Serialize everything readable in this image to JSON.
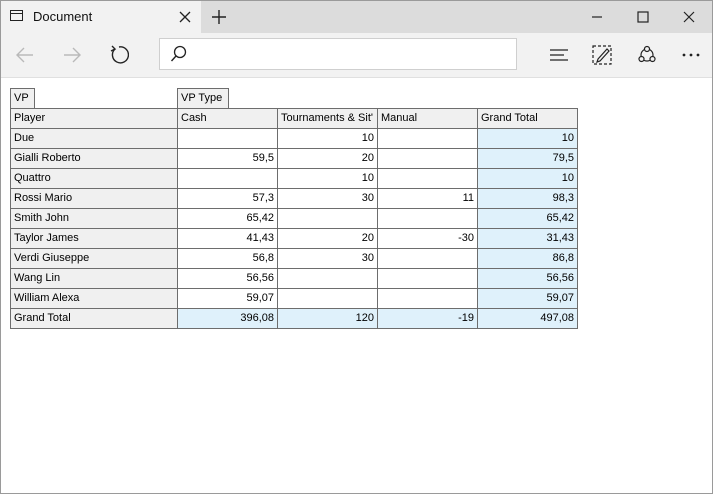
{
  "window": {
    "tab_title": "Document",
    "icons": {
      "tab": "document-icon",
      "close_tab": "close-icon",
      "new_tab": "plus-icon",
      "minimize": "minimize-icon",
      "maximize": "maximize-icon",
      "close": "close-icon"
    }
  },
  "navbar": {
    "address_value": "",
    "icons": {
      "back": "back-arrow-icon",
      "forward": "forward-arrow-icon",
      "refresh": "refresh-icon",
      "search": "search-icon",
      "hub": "hub-icon",
      "notes": "web-note-icon",
      "share": "share-icon",
      "more": "more-icon"
    }
  },
  "pivot": {
    "filter_field": "VP",
    "column_field": "VP Type",
    "row_header": "Player",
    "columns": [
      "Cash",
      "Tournaments & Sit'",
      "Manual",
      "Grand Total"
    ],
    "rows": [
      {
        "player": "Due",
        "values": [
          "",
          "10",
          "",
          "10"
        ]
      },
      {
        "player": "Gialli Roberto",
        "values": [
          "59,5",
          "20",
          "",
          "79,5"
        ]
      },
      {
        "player": "Quattro",
        "values": [
          "",
          "10",
          "",
          "10"
        ]
      },
      {
        "player": "Rossi Mario",
        "values": [
          "57,3",
          "30",
          "11",
          "98,3"
        ]
      },
      {
        "player": "Smith John",
        "values": [
          "65,42",
          "",
          "",
          "65,42"
        ]
      },
      {
        "player": "Taylor James",
        "values": [
          "41,43",
          "20",
          "-30",
          "31,43"
        ]
      },
      {
        "player": "Verdi Giuseppe",
        "values": [
          "56,8",
          "30",
          "",
          "86,8"
        ]
      },
      {
        "player": "Wang Lin",
        "values": [
          "56,56",
          "",
          "",
          "56,56"
        ]
      },
      {
        "player": "William Alexa",
        "values": [
          "59,07",
          "",
          "",
          "59,07"
        ]
      }
    ],
    "grand_total": {
      "label": "Grand Total",
      "values": [
        "396,08",
        "120",
        "-19",
        "497,08"
      ]
    },
    "colors": {
      "label_bg": "#f0f0f0",
      "total_bg": "#dff1fb",
      "border": "#6d6d6d"
    }
  }
}
